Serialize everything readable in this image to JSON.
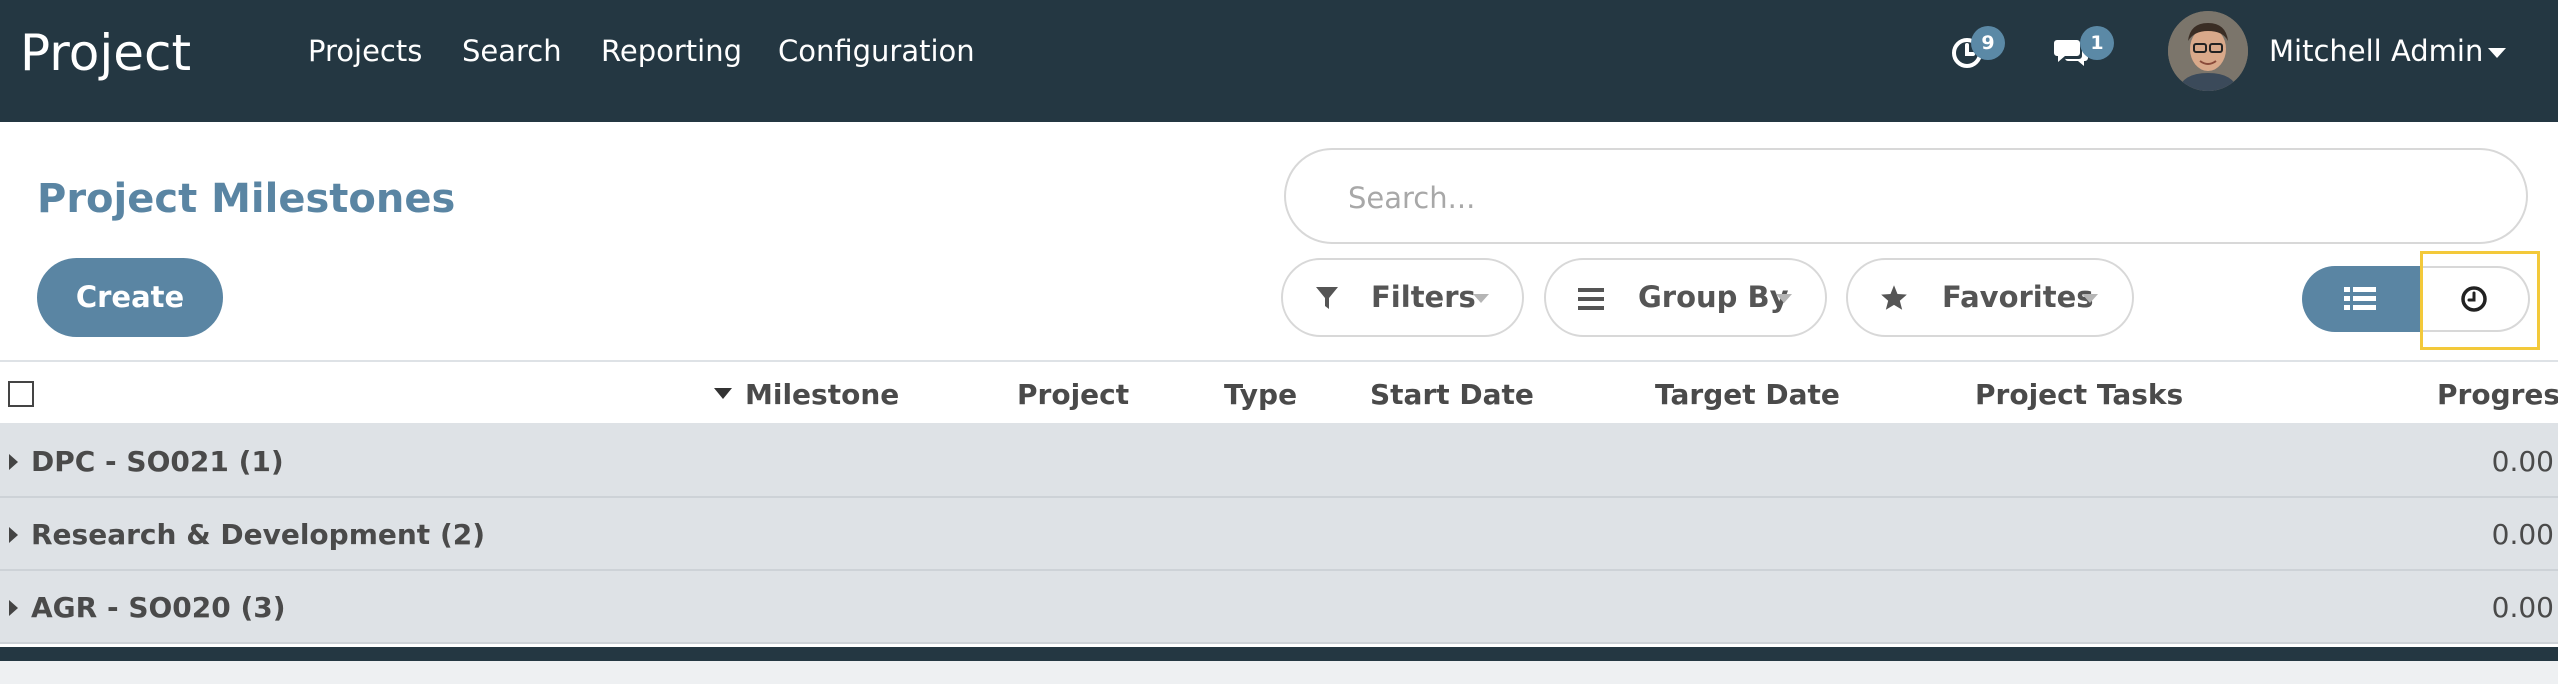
{
  "app": {
    "title": "Project"
  },
  "menu": [
    {
      "label": "Projects"
    },
    {
      "label": "Search"
    },
    {
      "label": "Reporting"
    },
    {
      "label": "Configuration"
    }
  ],
  "systray": {
    "activities_count": "9",
    "messages_count": "1",
    "user_name": "Mitchell Admin"
  },
  "control_panel": {
    "title": "Project Milestones",
    "search_placeholder": "Search...",
    "create_label": "Create",
    "filters_label": "Filters",
    "group_by_label": "Group By",
    "favorites_label": "Favorites"
  },
  "table": {
    "columns": [
      "Milestone",
      "Project",
      "Type",
      "Start Date",
      "Target Date",
      "Project Tasks",
      "Progress"
    ],
    "groups": [
      {
        "name": "DPC - SO021 (1)",
        "progress": "0.00"
      },
      {
        "name": "Research & Development (2)",
        "progress": "0.00"
      },
      {
        "name": "AGR - SO020 (3)",
        "progress": "0.00"
      }
    ]
  },
  "colors": {
    "navbar": "#243742",
    "accent": "#5a85a3",
    "badge": "#5b89a6",
    "group_row": "#dee2e6",
    "highlight": "#f3c93a"
  }
}
